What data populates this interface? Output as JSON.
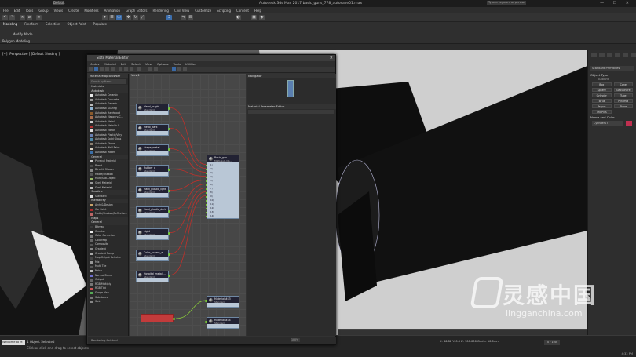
{
  "app": {
    "title": "Autodesk 3ds Max 2017   basic_guns_778_autosave01.max",
    "workspace": "Default",
    "search_placeholder": "Type a keyword or phrase"
  },
  "menu": [
    "File",
    "Edit",
    "Tools",
    "Group",
    "Views",
    "Create",
    "Modifiers",
    "Animation",
    "Graph Editors",
    "Rendering",
    "Civil View",
    "Customize",
    "Scripting",
    "Content",
    "Help"
  ],
  "ribbon": {
    "tabs": [
      "Modeling",
      "Freeform",
      "Selection",
      "Object Paint",
      "Populate"
    ],
    "active_tab": "Modeling",
    "modify_mode": "Modify Mode",
    "panel_label": "Polygon Modeling"
  },
  "viewport": {
    "label": "[+] [Perspective ] [Default Shading ]"
  },
  "command_panel": {
    "dropdown": "Standard Primitives",
    "object_type_header": "Object Type",
    "autogrid": "AutoGrid",
    "object_types": [
      "Box",
      "Cone",
      "Sphere",
      "GeoSphere",
      "Cylinder",
      "Tube",
      "Torus",
      "Pyramid",
      "Teapot",
      "Plane",
      "TextPlus",
      ""
    ],
    "name_color_header": "Name and Color",
    "name_value": "Cylinder177"
  },
  "slate": {
    "title": "Slate Material Editor",
    "menu": [
      "Modes",
      "Material",
      "Edit",
      "Select",
      "View",
      "Options",
      "Tools",
      "Utilities"
    ],
    "browser_header": "Material/Map Browser",
    "search_placeholder": "Search by Name ...",
    "groups": [
      {
        "label": "- Materials",
        "items": []
      },
      {
        "label": "- Autodesk",
        "items": [
          {
            "label": "Autodesk Ceramic",
            "color": "#e8e8e8"
          },
          {
            "label": "Autodesk Concrete",
            "color": "#9a9a9a"
          },
          {
            "label": "Autodesk Generic",
            "color": "#bbbbbb"
          },
          {
            "label": "Autodesk Glazing",
            "color": "#8fb3d0"
          },
          {
            "label": "Autodesk Hardwood",
            "color": "#8a5a2b"
          },
          {
            "label": "Autodesk Masonry/C...",
            "color": "#a86e4d"
          },
          {
            "label": "Autodesk Metal",
            "color": "#cfcfcf"
          },
          {
            "label": "Autodesk Metallic P...",
            "color": "#b03030"
          },
          {
            "label": "Autodesk Mirror",
            "color": "#dddddd"
          },
          {
            "label": "Autodesk Plastic/Vinyl",
            "color": "#6a7fb0"
          },
          {
            "label": "Autodesk Solid Glass",
            "color": "#4c88a8"
          },
          {
            "label": "Autodesk Stone",
            "color": "#8c8070"
          },
          {
            "label": "Autodesk Wall Paint",
            "color": "#d8d0c0"
          },
          {
            "label": "Autodesk Water",
            "color": "#3b6fa8"
          }
        ]
      },
      {
        "label": "- General",
        "items": [
          {
            "label": "Physical Material",
            "color": "#cccccc"
          },
          {
            "label": "Blend",
            "color": "#4a4a4a"
          },
          {
            "label": "DirectX Shader",
            "color": "#888888"
          },
          {
            "label": "Matte/Shadow",
            "color": "#555555"
          },
          {
            "label": "Multi/Sub-Object",
            "color": "#9b6"
          },
          {
            "label": "Shell Material",
            "color": "#999999"
          },
          {
            "label": "Shell Material",
            "color": "#bbbbbb"
          }
        ]
      },
      {
        "label": "- Scanline",
        "items": [
          {
            "label": "Standard",
            "color": "#dddddd"
          }
        ]
      },
      {
        "label": "- mental ray",
        "items": [
          {
            "label": "Arch & Design",
            "color": "#c9a26a"
          },
          {
            "label": "Car Paint",
            "color": "#b02a2a"
          },
          {
            "label": "Matte/Shadow/Reflectio...",
            "color": "#bb6666"
          }
        ]
      },
      {
        "label": "- Maps",
        "items": []
      },
      {
        "label": "- General",
        "items": [
          {
            "label": "Bitmap",
            "color": "#3a3a3a"
          },
          {
            "label": "Checker",
            "color": "#eeeeee"
          },
          {
            "label": "Color Correction",
            "color": "#777777"
          },
          {
            "label": "ColorMap",
            "color": "#666666"
          },
          {
            "label": "Composite",
            "color": "#555555"
          },
          {
            "label": "Gradient",
            "color": "#888888"
          },
          {
            "label": "Gradient Ramp",
            "color": "#aaaaaa"
          },
          {
            "label": "Map Output Selector",
            "color": "#444444"
          },
          {
            "label": "Mix",
            "color": "#999999"
          },
          {
            "label": "Multi Tile",
            "color": "#555555"
          },
          {
            "label": "Noise",
            "color": "#bbbbbb"
          },
          {
            "label": "Normal Bump",
            "color": "#6f6fcf"
          },
          {
            "label": "Output",
            "color": "#666666"
          },
          {
            "label": "RGB Multiply",
            "color": "#777777"
          },
          {
            "label": "RGB Tint",
            "color": "#cc5555"
          },
          {
            "label": "Shape Map",
            "color": "#55aa55"
          },
          {
            "label": "Substance",
            "color": "#777777"
          },
          {
            "label": "Swirl",
            "color": "#888888"
          }
        ]
      }
    ],
    "view_tab": "View1",
    "nodes": [
      {
        "name": "Metal_bright",
        "type": "Standard"
      },
      {
        "name": "Metal_dark",
        "type": "Standard"
      },
      {
        "name": "shape_metal",
        "type": "Standard"
      },
      {
        "name": "Rubber_a",
        "type": "Standard"
      },
      {
        "name": "Hard_plastic_light",
        "type": "Standard"
      },
      {
        "name": "Hard_plastic_dark",
        "type": "Standard"
      },
      {
        "name": "Light",
        "type": "Standard"
      },
      {
        "name": "Color_accent_a",
        "type": "Standard"
      },
      {
        "name": "Hospital_metal_...",
        "type": "Standard"
      }
    ],
    "main_node": {
      "name": "Basic_gun...",
      "type": "Multi/Sub-Ob...",
      "slots": [
        "(1)",
        "(2)",
        "(3)",
        "(4)",
        "(5)",
        "(6)",
        "(7)",
        "(8)",
        "(9)",
        "(10)",
        "(11)",
        "(12)",
        "(13)",
        "(14)"
      ]
    },
    "extra_nodes": [
      {
        "name": "Material #43",
        "type": "Standard"
      },
      {
        "name": "Material #44",
        "type": "Standard"
      }
    ],
    "navigator_header": "Navigator",
    "param_header": "Material Parameter Editor",
    "status": "Rendering finished",
    "zoom": "100%"
  },
  "status": {
    "maxscript": "Welcome to M",
    "line1": "1 Object Selected",
    "line2": "Click or click-and-drag to select objects",
    "coords": "X: 86.88   Y: 0.0   Z: 100.000   Grid = 10.0mm",
    "frame": "0 / 100",
    "add_time_tag": "Add Time Tag",
    "time": "4:33 PM"
  },
  "watermark": {
    "cn": "灵感中国",
    "url": "lingganchina.com"
  }
}
